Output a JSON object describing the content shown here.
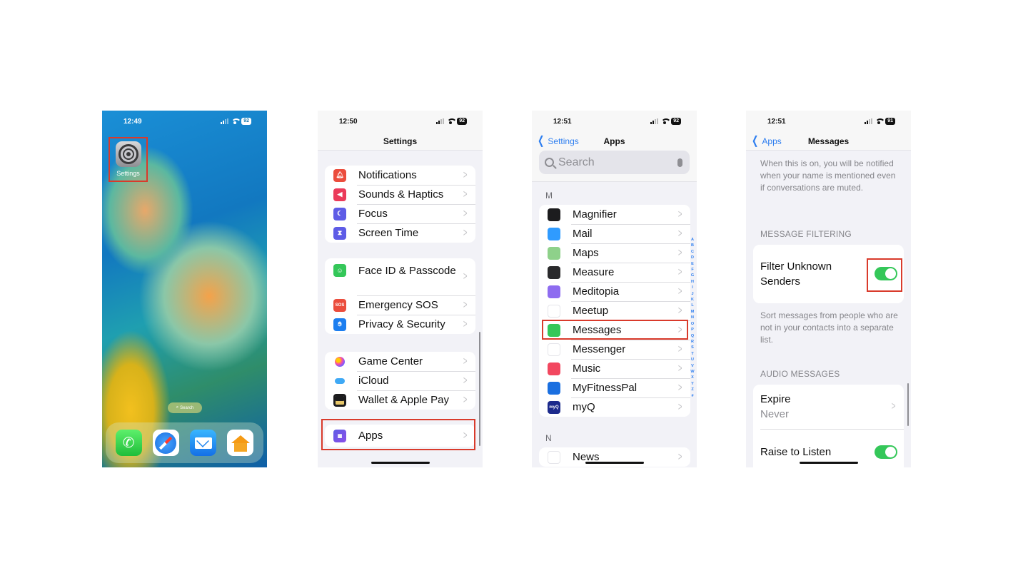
{
  "screens": [
    {
      "id": "home",
      "status": {
        "time": "12:49",
        "battery": "92"
      },
      "app_icon_label": "Settings",
      "search_pill": "Search",
      "dock": [
        "Phone",
        "Safari",
        "Mail",
        "Home"
      ]
    },
    {
      "id": "settings",
      "status": {
        "time": "12:50",
        "battery": "92"
      },
      "title": "Settings",
      "groups": [
        [
          {
            "label": "Notifications",
            "icon": "bell-icon",
            "color": "#eb4d3d"
          },
          {
            "label": "Sounds & Haptics",
            "icon": "speaker-icon",
            "color": "#eb3b5a"
          },
          {
            "label": "Focus",
            "icon": "moon-icon",
            "color": "#5e5ce6"
          },
          {
            "label": "Screen Time",
            "icon": "hourglass-icon",
            "color": "#5e5ce6"
          }
        ],
        [
          {
            "label": "Face ID & Passcode",
            "icon": "faceid-icon",
            "color": "#34c759"
          },
          {
            "label": "Emergency SOS",
            "icon": "sos-icon",
            "color": "#eb4d3d",
            "glyph": "SOS"
          },
          {
            "label": "Privacy & Security",
            "icon": "hand-icon",
            "color": "#1c7ef0"
          }
        ],
        [
          {
            "label": "Game Center",
            "icon": "game-center-icon",
            "color": "#ffffff"
          },
          {
            "label": "iCloud",
            "icon": "cloud-icon",
            "color": "#ffffff"
          },
          {
            "label": "Wallet & Apple Pay",
            "icon": "wallet-icon",
            "color": "#1c1c1e"
          }
        ],
        [
          {
            "label": "Apps",
            "icon": "apps-grid-icon",
            "color": "#5e5ce6"
          }
        ]
      ]
    },
    {
      "id": "apps",
      "status": {
        "time": "12:51",
        "battery": "92"
      },
      "back_label": "Settings",
      "title": "Apps",
      "search_placeholder": "Search",
      "sections": [
        {
          "letter": "M",
          "items": [
            {
              "label": "Magnifier",
              "icon": "magnifier-icon",
              "color": "#1c1c1e"
            },
            {
              "label": "Mail",
              "icon": "mail-icon",
              "color": "#2f9bff"
            },
            {
              "label": "Maps",
              "icon": "maps-icon",
              "color": "#8ed18a"
            },
            {
              "label": "Measure",
              "icon": "measure-icon",
              "color": "#2a2a2c"
            },
            {
              "label": "Meditopia",
              "icon": "meditopia-icon",
              "color": "#8e6cf0"
            },
            {
              "label": "Meetup",
              "icon": "meetup-icon",
              "color": "#ffffff"
            },
            {
              "label": "Messages",
              "icon": "messages-icon",
              "color": "#34c759"
            },
            {
              "label": "Messenger",
              "icon": "messenger-icon",
              "color": "#ffffff"
            },
            {
              "label": "Music",
              "icon": "music-icon",
              "color": "#f2475f"
            },
            {
              "label": "MyFitnessPal",
              "icon": "myfitnesspal-icon",
              "color": "#1a6fe0"
            },
            {
              "label": "myQ",
              "icon": "myq-icon",
              "color": "#1c2a8c",
              "glyph": "myQ"
            }
          ]
        },
        {
          "letter": "N",
          "items": [
            {
              "label": "News",
              "icon": "news-icon",
              "color": "#ffffff"
            }
          ]
        }
      ],
      "index": [
        "A",
        "B",
        "C",
        "D",
        "E",
        "F",
        "G",
        "H",
        "I",
        "J",
        "K",
        "L",
        "M",
        "N",
        "O",
        "P",
        "Q",
        "R",
        "S",
        "T",
        "U",
        "V",
        "W",
        "X",
        "Y",
        "Z",
        "#"
      ]
    },
    {
      "id": "messages",
      "status": {
        "time": "12:51",
        "battery": "91"
      },
      "back_label": "Apps",
      "title": "Messages",
      "mention_footnote": "When this is on, you will be notified when your name is mentioned even if conversations are muted.",
      "filtering_header": "MESSAGE FILTERING",
      "filter_label": "Filter Unknown Senders",
      "filter_on": true,
      "filter_footnote": "Sort messages from people who are not in your contacts into a separate list.",
      "audio_header": "AUDIO MESSAGES",
      "expire_label": "Expire",
      "expire_value": "Never",
      "raise_label": "Raise to Listen",
      "raise_on": true
    }
  ],
  "highlight_color": "#d93a2b",
  "accent_color": "#2f7ff0",
  "toggle_on_color": "#34c759"
}
